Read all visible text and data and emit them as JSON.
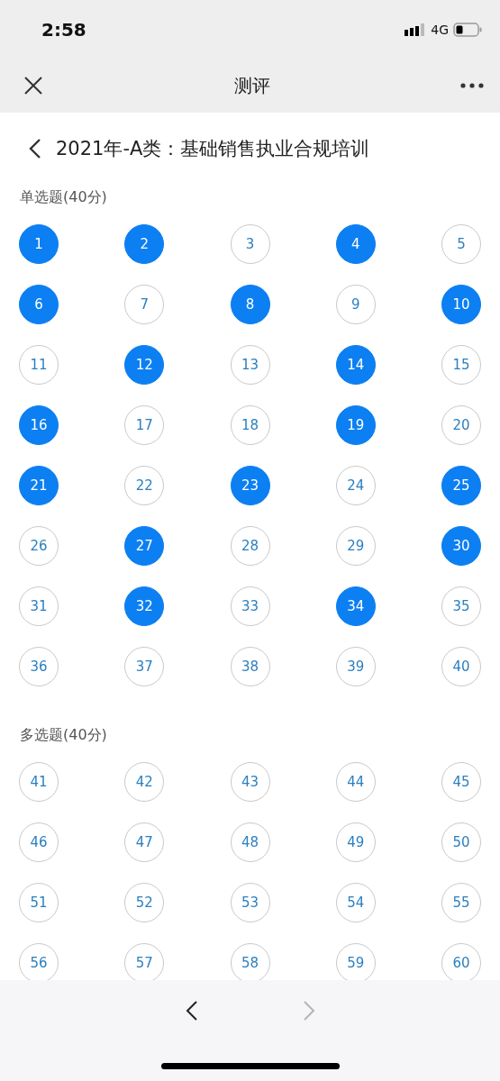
{
  "status_bar": {
    "time": "2:58",
    "network": "4G"
  },
  "nav_bar": {
    "title": "测评"
  },
  "header": {
    "title": "2021年-A类：基础销售执业合规培训"
  },
  "sections": [
    {
      "label": "单选题(40分)",
      "questions": [
        {
          "number": "1",
          "answered": true
        },
        {
          "number": "2",
          "answered": true
        },
        {
          "number": "3",
          "answered": false
        },
        {
          "number": "4",
          "answered": true
        },
        {
          "number": "5",
          "answered": false
        },
        {
          "number": "6",
          "answered": true
        },
        {
          "number": "7",
          "answered": false
        },
        {
          "number": "8",
          "answered": true
        },
        {
          "number": "9",
          "answered": false
        },
        {
          "number": "10",
          "answered": true
        },
        {
          "number": "11",
          "answered": false
        },
        {
          "number": "12",
          "answered": true
        },
        {
          "number": "13",
          "answered": false
        },
        {
          "number": "14",
          "answered": true
        },
        {
          "number": "15",
          "answered": false
        },
        {
          "number": "16",
          "answered": true
        },
        {
          "number": "17",
          "answered": false
        },
        {
          "number": "18",
          "answered": false
        },
        {
          "number": "19",
          "answered": true
        },
        {
          "number": "20",
          "answered": false
        },
        {
          "number": "21",
          "answered": true
        },
        {
          "number": "22",
          "answered": false
        },
        {
          "number": "23",
          "answered": true
        },
        {
          "number": "24",
          "answered": false
        },
        {
          "number": "25",
          "answered": true
        },
        {
          "number": "26",
          "answered": false
        },
        {
          "number": "27",
          "answered": true
        },
        {
          "number": "28",
          "answered": false
        },
        {
          "number": "29",
          "answered": false
        },
        {
          "number": "30",
          "answered": true
        },
        {
          "number": "31",
          "answered": false
        },
        {
          "number": "32",
          "answered": true
        },
        {
          "number": "33",
          "answered": false
        },
        {
          "number": "34",
          "answered": true
        },
        {
          "number": "35",
          "answered": false
        },
        {
          "number": "36",
          "answered": false
        },
        {
          "number": "37",
          "answered": false
        },
        {
          "number": "38",
          "answered": false
        },
        {
          "number": "39",
          "answered": false
        },
        {
          "number": "40",
          "answered": false
        }
      ]
    },
    {
      "label": "多选题(40分)",
      "questions": [
        {
          "number": "41",
          "answered": false
        },
        {
          "number": "42",
          "answered": false
        },
        {
          "number": "43",
          "answered": false
        },
        {
          "number": "44",
          "answered": false
        },
        {
          "number": "45",
          "answered": false
        },
        {
          "number": "46",
          "answered": false
        },
        {
          "number": "47",
          "answered": false
        },
        {
          "number": "48",
          "answered": false
        },
        {
          "number": "49",
          "answered": false
        },
        {
          "number": "50",
          "answered": false
        },
        {
          "number": "51",
          "answered": false
        },
        {
          "number": "52",
          "answered": false
        },
        {
          "number": "53",
          "answered": false
        },
        {
          "number": "54",
          "answered": false
        },
        {
          "number": "55",
          "answered": false
        },
        {
          "number": "56",
          "answered": false
        },
        {
          "number": "57",
          "answered": false
        },
        {
          "number": "58",
          "answered": false
        },
        {
          "number": "59",
          "answered": false
        },
        {
          "number": "60",
          "answered": false
        }
      ]
    }
  ],
  "pager": [
    {
      "kind": "prev",
      "disabled": false
    },
    {
      "kind": "next",
      "disabled": true
    }
  ]
}
